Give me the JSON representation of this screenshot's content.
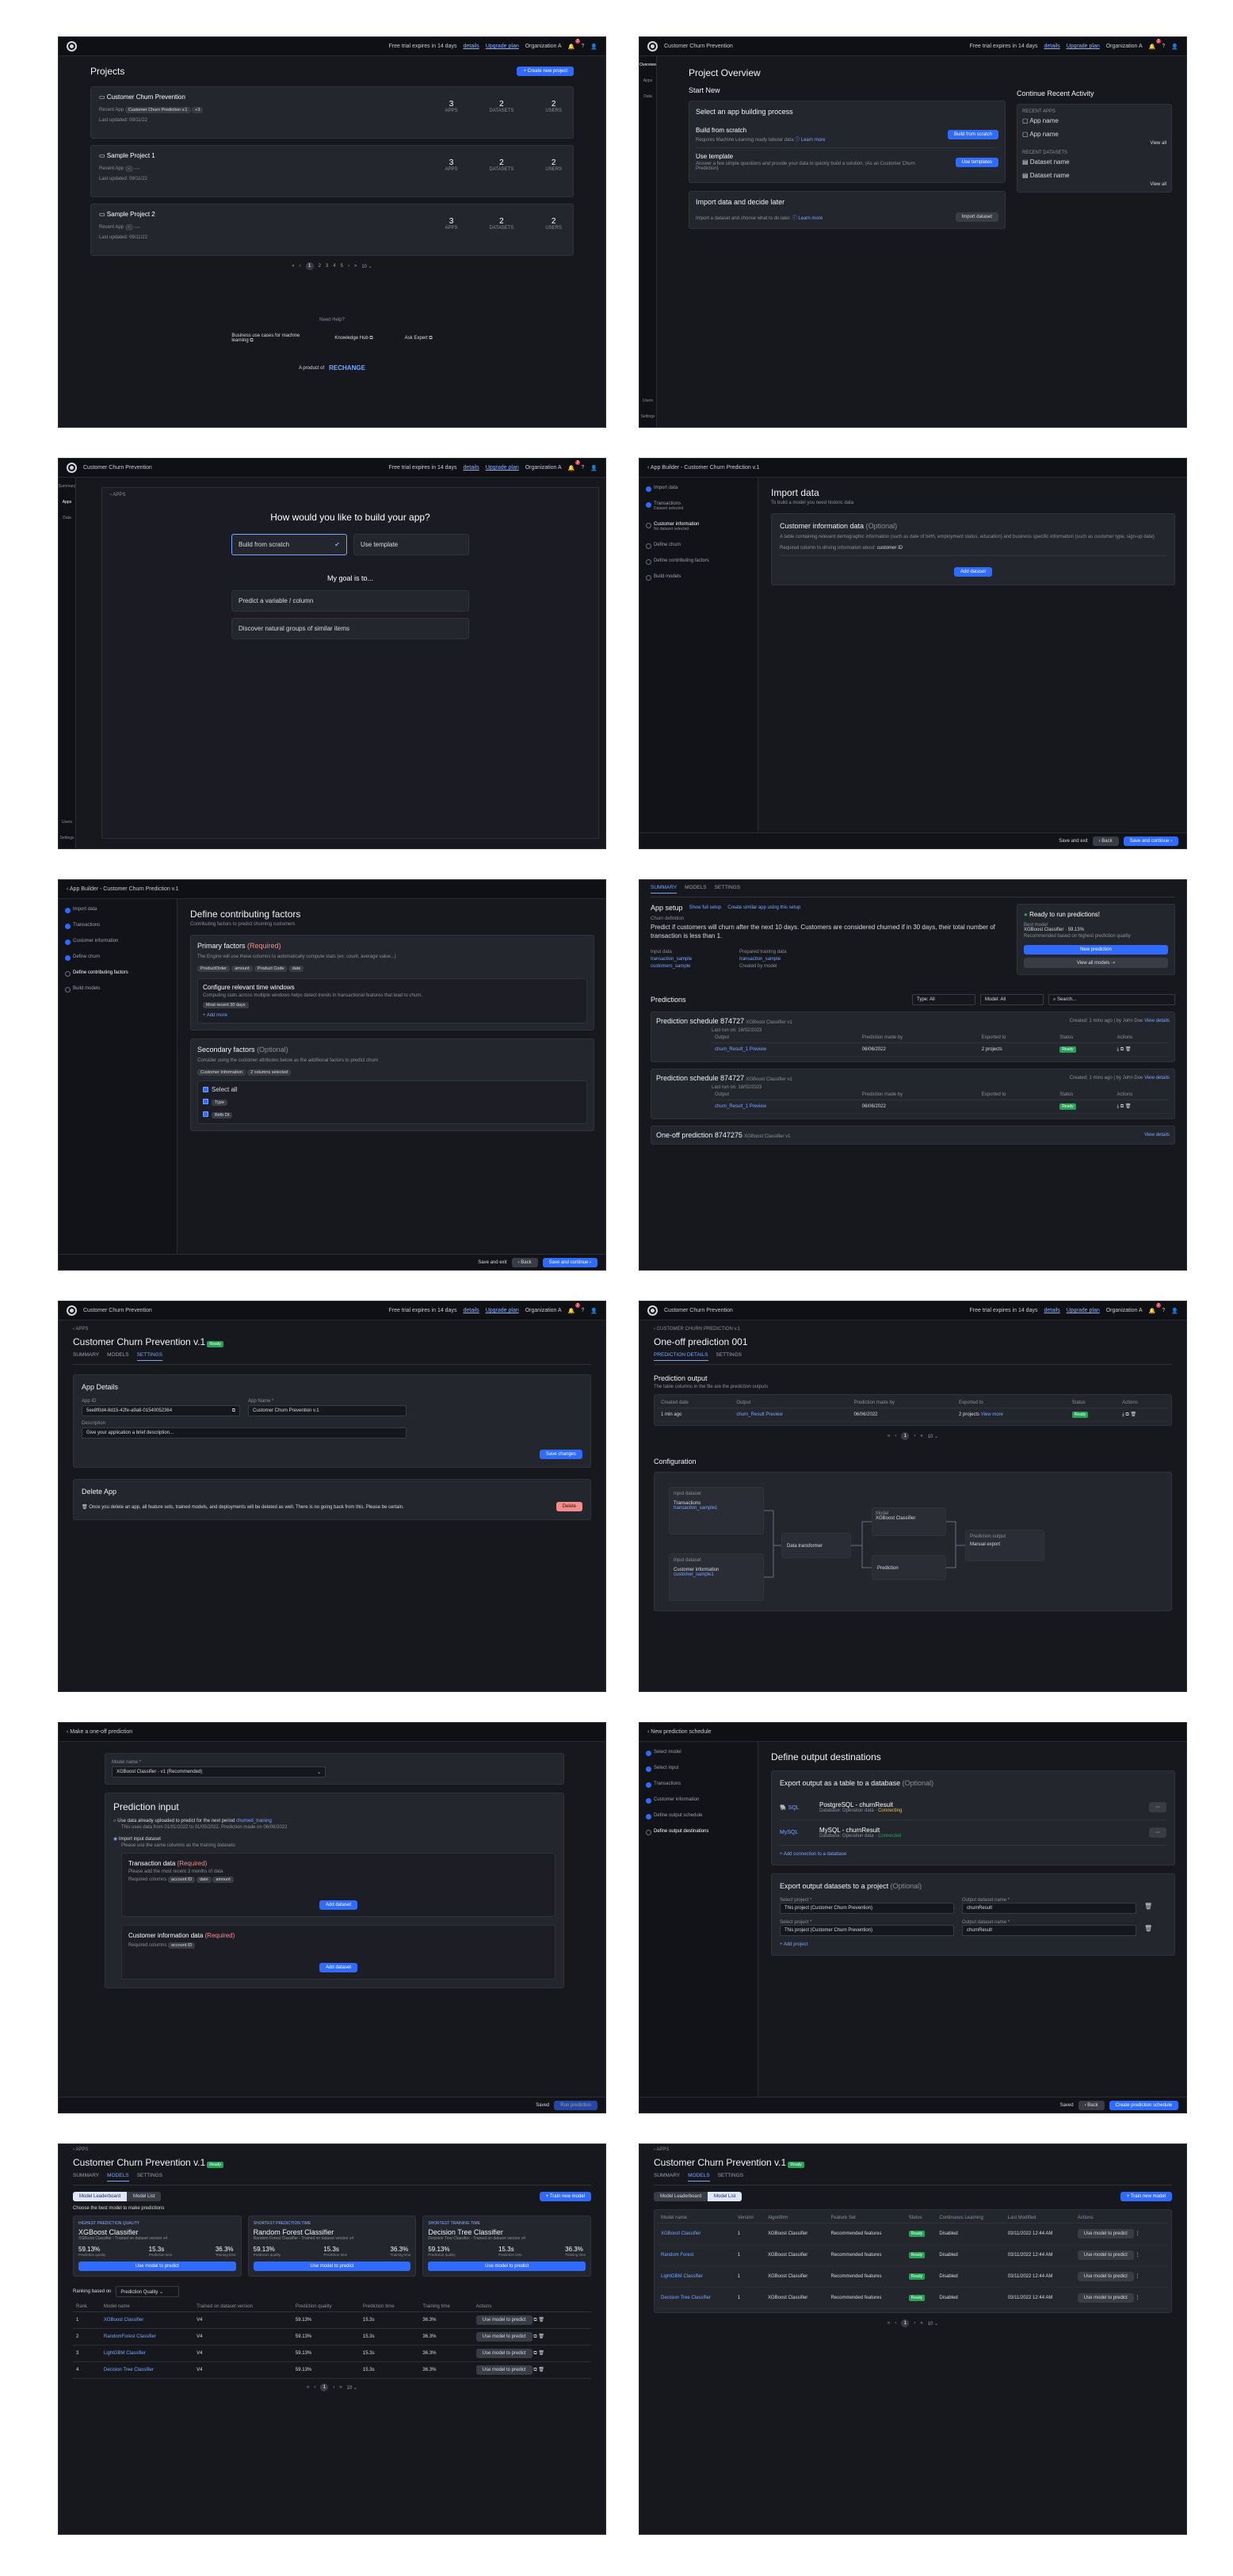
{
  "common": {
    "project_name": "Customer Churn Prevention",
    "trial": "Free trial expires in 14 days",
    "details": "details",
    "upgrade": "Upgrade plan",
    "org": "Organization A",
    "notif_count": "2"
  },
  "p1": {
    "title": "Projects",
    "create": "+ Create new project",
    "projects": [
      {
        "name": "Customer Churn Prevention",
        "recent_label": "Recent App",
        "recent_app": "Customer Churn Prediction v.1",
        "recent_more": "+3",
        "updated": "Last updated: 09/11/22",
        "apps": "3",
        "datasets": "2",
        "users": "2"
      },
      {
        "name": "Sample Project 1",
        "recent_label": "Recent App",
        "recent_app": "-",
        "recent_more": "",
        "updated": "Last updated: 09/11/22",
        "apps": "3",
        "datasets": "2",
        "users": "2"
      },
      {
        "name": "Sample Project 2",
        "recent_label": "Recent App",
        "recent_app": "-",
        "recent_more": "",
        "updated": "Last updated: 09/11/22",
        "apps": "3",
        "datasets": "2",
        "users": "2"
      }
    ],
    "stat_labels": [
      "APPS",
      "DATASETS",
      "USERS"
    ],
    "pages": [
      "«",
      "‹",
      "1",
      "2",
      "3",
      "4",
      "5",
      "›",
      "»",
      "10 ⌄"
    ],
    "help": "Need Help?",
    "help_items": [
      "Business use cases for machine learning ⧉",
      "Knowledge Hub ⧉",
      "Ask Expert ⧉"
    ],
    "product_of": "A product of",
    "brand": "RECHANGE"
  },
  "p2": {
    "title": "Project Overview",
    "start_new": "Start New",
    "select_process": "Select an app building process",
    "scratch_title": "Build from scratch",
    "scratch_desc": "Requires Machine Learning ready tabular data",
    "scratch_btn": "Build from scratch",
    "template_title": "Use template",
    "template_desc": "Answer a few simple questions and provide your data to quickly build a solution. (As an Customer Churn Prediction)",
    "template_btn": "Use templates",
    "learn_more": "ⓘ Learn more",
    "import_title": "Import data and decide later",
    "import_desc": "Import a dataset and choose what to do later.",
    "import_btn": "Import dataset",
    "continue": "Continue Recent Activity",
    "recent_apps": "RECENT APPS",
    "app_items": [
      "App name",
      "App name"
    ],
    "recent_datasets": "RECENT DATASETS",
    "dataset_items": [
      "Dataset name",
      "Dataset name"
    ],
    "view_all": "View all",
    "rail": [
      "Overview",
      "Apps",
      "Data",
      "Users",
      "Settings"
    ]
  },
  "p3": {
    "back": "‹  APPS",
    "question": "How would you like to build your app?",
    "opt1": "Build from scratch",
    "opt2": "Use template",
    "goal": "My goal is to...",
    "goal1": "Predict a variable / column",
    "goal2": "Discover natural groups of similar items",
    "rail": [
      "Summary",
      "Apps",
      "Data",
      "Users",
      "Settings"
    ]
  },
  "p4": {
    "header": "‹  App Builder - Customer Churn Prediction v.1",
    "steps": [
      "Import data",
      "Transactions",
      "Customer information",
      "Define churn",
      "Define contributing factors",
      "Build models"
    ],
    "step_subs": [
      "",
      "Dataset selected",
      "No dataset selected",
      "",
      "",
      ""
    ],
    "title": "Import data",
    "sub": "To build a model you need historic data",
    "card_title": "Customer information data",
    "optional": "(Optional)",
    "card_desc": "A table containing relevant demographic information (such as date of birth, employment status, education) and business specific information (such as customer type, sign-up date)",
    "required": "Required column to driving information about:",
    "required_val": "customer ID",
    "add": "Add dataset",
    "save_exit": "Save and exit",
    "back_btn": "‹  Back",
    "continue": "Save and continue  ›"
  },
  "p5": {
    "title": "Define contributing factors",
    "sub": "Contributing factors to predict churning customers",
    "primary": "Primary factors",
    "primary_req": "(Required)",
    "primary_desc": "The Engine will use these columns to automatically compute stats (ex: count, average value...)",
    "chips": [
      "ProductOrder",
      "amount",
      "Product Code",
      "date"
    ],
    "config_title": "Configure relevant time windows",
    "config_desc": "Computing stats across multiple windows helps detect trends in transactional features that lead to churn.",
    "window": "Most recent 30 days",
    "add_more": "+ Add more",
    "secondary": "Secondary factors",
    "secondary_opt": "(Optional)",
    "secondary_desc": "Consider using the customer attributes below as the additional factors to predict churn",
    "sec_chip1": "Customer Information",
    "sec_chip2": "2 columns selected",
    "checks": [
      "Select all",
      "Type",
      "Birth Dt"
    ],
    "save_exit": "Save and exit",
    "back_btn": "‹  Back",
    "continue": "Save and continue  ›"
  },
  "p6": {
    "tabs": [
      "SUMMARY",
      "MODELS",
      "SETTINGS"
    ],
    "app_setup": "App setup",
    "show_full": "Show full setup",
    "create_similar": "Create similar app using this setup",
    "churn_def_label": "Churn definition",
    "churn_def": "Predict if customers will churn after the next 10 days. Customers are considered churned if in 30 days, their total number of transaction is less than 1.",
    "input_label": "Input data",
    "inputs": [
      "transaction_sample",
      "customers_sample"
    ],
    "prepared_label": "Prepared training data",
    "prepared": [
      "transaction_sample",
      "Created by model"
    ],
    "ready": "Ready to run predictions!",
    "best_model_label": "Best model",
    "best_model": "XGBoost Classifier",
    "best_val": "59.13%",
    "best_note": "Recommended based on highest prediction quality",
    "new_pred": "New prediction",
    "view_models": "View all models  ⇢",
    "pred_title": "Predictions",
    "type_filter": "Type: All",
    "model_filter": "Model: All",
    "search": "Search...",
    "schedules": [
      {
        "name": "Prediction schedule 874727",
        "model": "XGBoost Classifier v1",
        "created": "Created: 1 mins ago | by John Doe",
        "run": "Last run on: 18/02/2023",
        "output": "churn_Result_1",
        "date": "06/06/2022",
        "exported": "2 projects",
        "status": "Ready"
      },
      {
        "name": "Prediction schedule 874727",
        "model": "XGBoost Classifier v1",
        "created": "Created: 1 mins ago | by John Doe",
        "run": "Last run on: 18/02/2023",
        "output": "churn_Result_1",
        "date": "06/06/2022",
        "exported": "",
        "status": "Ready"
      }
    ],
    "oneoff": "One-off prediction 8747275",
    "oneoff_model": "XGBoost Classifier v1",
    "view_details": "View details",
    "preview": "Preview",
    "view_more": "View more",
    "col_output": "Output",
    "col_made": "Prediction made by",
    "col_exported": "Exported to",
    "col_status": "Status",
    "col_actions": "Actions"
  },
  "p7": {
    "crumb": "‹  APPS",
    "app_title": "Customer Churn Prevention v.1",
    "ready": "Ready",
    "tabs": [
      "SUMMARY",
      "MODELS",
      "SETTINGS"
    ],
    "details": "App Details",
    "appid_label": "App ID",
    "appid": "5ee8f0d4-8d15-42fe-a9a8-01540052364",
    "name_label": "App Name *",
    "name": "Customer Churn Prevention v.1",
    "desc_label": "Description",
    "desc_ph": "Give your application a brief description...",
    "save": "Save changes",
    "delete_title": "Delete App",
    "delete_desc": "Once you delete an app, all feature sets, trained models, and deployments will be deleted as well. There is no going back from this. Please be certain.",
    "delete_btn": "Delete"
  },
  "p8": {
    "crumb": "‹  CUSTOMER CHURN PREDICTION v.1",
    "title": "One-off prediction 001",
    "tabs": [
      "PREDICTION DETAILS",
      "SETTINGS"
    ],
    "output_title": "Prediction output",
    "output_sub": "The table columns in the file are the prediction outputs",
    "cols": [
      "Created date",
      "Output",
      "Prediction made by",
      "Exported to",
      "Status",
      "Actions"
    ],
    "row": [
      "1 min ago",
      "churn_Result",
      "06/06/2022",
      "2 projects",
      "Ready"
    ],
    "config": "Configuration",
    "nodes": [
      "Input dataset",
      "Transactions",
      "transaction_sample1",
      "Input dataset",
      "Customer information",
      "customer_sample1",
      "Data transformer",
      "Model",
      "XGBoost Classifier",
      "Prediction",
      "Prediction output",
      "Manual export"
    ]
  },
  "p9": {
    "header": "‹  Make a one-off prediction",
    "model_label": "Model name *",
    "model": "XGBoost Classifier - v1 (Recommended)",
    "input_title": "Prediction input",
    "opt1": "Use data already uploaded to predict for the next period",
    "opt1_chip": "churned_training",
    "opt1_sub": "This uses data from 01/01/2022 to 01/05/2022. Prediction made on 06/06/2022",
    "opt2": "Import input dataset",
    "opt2_sub": "Please use the same columns as the training datasets",
    "tx_title": "Transaction data",
    "tx_req": "(Required)",
    "tx_desc": "Please add the most recent 3 months of data",
    "req_cols": "Required columns",
    "tx_cols": [
      "account ID",
      "date",
      "amount"
    ],
    "add": "Add dataset",
    "ci_title": "Customer information data",
    "ci_req": "(Required)",
    "ci_cols": [
      "account ID"
    ],
    "saved": "Saved",
    "run": "Run prediction"
  },
  "p10": {
    "header": "‹  New prediction schedule",
    "steps": [
      "Select model",
      "Select input",
      "Transactions",
      "Customer information",
      "Define output schedule",
      "Define output destinations"
    ],
    "title": "Define output destinations",
    "export_db": "Export output as a table to a database",
    "optional": "(Optional)",
    "db1": "PostgreSQL - churnResult",
    "db1_sub": "Database: Operation data",
    "db1_status": "Connecting",
    "db2": "MySQL - churnResult",
    "db2_sub": "Database: Operation data",
    "db2_status": "Connected",
    "add_conn": "+ Add connection to a database",
    "export_proj": "Export output datasets to a project",
    "project_label": "Select project *",
    "project": "This project (Customer Churn Prevention)",
    "out_label": "Output dataset name *",
    "out": "churnResult",
    "add_project": "+ Add project",
    "saved": "Saved",
    "back_btn": "‹  Back",
    "create": "Create prediction schedule"
  },
  "p11": {
    "crumb": "‹  APPS",
    "app_title": "Customer Churn Prevention v.1",
    "ready": "Ready",
    "tabs": [
      "SUMMARY",
      "MODELS",
      "SETTINGS"
    ],
    "toggle": [
      "Model Leaderboard",
      "Model List"
    ],
    "train": "+ Train new model",
    "choose": "Choose the best model to make predictions",
    "cards": [
      {
        "tag": "HIGHEST PREDICTION QUALITY",
        "name": "XGBoost Classifier",
        "sub": "XGBoost Classifier - Trained on dataset version v4",
        "q": "59.13%",
        "t": "15.3s",
        "a": "36.3%"
      },
      {
        "tag": "SHORTEST PREDICTION TIME",
        "name": "Random Forest Classifier",
        "sub": "Random Forest Classifier - Trained on dataset version v4",
        "q": "59.13%",
        "t": "15.3s",
        "a": "36.3%"
      },
      {
        "tag": "SHORTEST TRAINING TIME",
        "name": "Decision Tree Classifier",
        "sub": "Decision Tree Classifier - Trained on dataset version v4",
        "q": "59.13%",
        "t": "15.3s",
        "a": "36.3%"
      }
    ],
    "metric_labels": [
      "Prediction quality",
      "Prediction time",
      "Training time"
    ],
    "use": "Use model to predict",
    "ranking": "Ranking based on",
    "ranking_val": "Prediction Quality ⌄",
    "cols": [
      "Rank",
      "Model name",
      "Trained on dataset version",
      "Prediction quality",
      "Prediction time",
      "Training time",
      "Actions"
    ],
    "rows": [
      {
        "rank": "1",
        "name": "XGBoost Classifier",
        "ver": "V4",
        "q": "59.13%",
        "p": "15.3s",
        "t": "36.3%"
      },
      {
        "rank": "2",
        "name": "RandomForest Classifier",
        "ver": "V4",
        "q": "59.13%",
        "p": "15.3s",
        "t": "36.3%"
      },
      {
        "rank": "3",
        "name": "LightGBM Classifier",
        "ver": "V4",
        "q": "59.13%",
        "p": "15.3s",
        "t": "36.3%"
      },
      {
        "rank": "4",
        "name": "Decision Tree Classifier",
        "ver": "V4",
        "q": "59.13%",
        "p": "15.3s",
        "t": "36.3%"
      }
    ],
    "pages": [
      "«",
      "‹",
      "1",
      "›",
      "»",
      "10 ⌄"
    ]
  },
  "p12": {
    "crumb": "‹  APPS",
    "app_title": "Customer Churn Prevention v.1",
    "ready": "Ready",
    "tabs": [
      "SUMMARY",
      "MODELS",
      "SETTINGS"
    ],
    "toggle": [
      "Model Leaderboard",
      "Model List"
    ],
    "train": "+ Train new model",
    "cols": [
      "Model name",
      "Version",
      "Algorithm",
      "Feature Set",
      "Status",
      "Continuous Learning",
      "Last Modified",
      "Actions"
    ],
    "rows": [
      {
        "name": "XGBoost Classifier",
        "ver": "1",
        "alg": "XGBoost Classifier",
        "fs": "Recommended features",
        "st": "Ready",
        "cl": "Disabled",
        "mod": "03/11/2022 12:44 AM"
      },
      {
        "name": "Random Forest",
        "ver": "1",
        "alg": "XGBoost Classifier",
        "fs": "Recommended features",
        "st": "Ready",
        "cl": "Disabled",
        "mod": "03/11/2022 12:44 AM"
      },
      {
        "name": "LightGBM Classifier",
        "ver": "1",
        "alg": "XGBoost Classifier",
        "fs": "Recommended features",
        "st": "Ready",
        "cl": "Disabled",
        "mod": "03/11/2022 12:44 AM"
      },
      {
        "name": "Decision Tree Classifier",
        "ver": "1",
        "alg": "XGBoost Classifier",
        "fs": "Recommended features",
        "st": "Ready",
        "cl": "Disabled",
        "mod": "03/11/2022 12:44 AM"
      }
    ],
    "use": "Use model to predict",
    "pages": [
      "«",
      "‹",
      "1",
      "›",
      "»",
      "10 ⌄"
    ]
  }
}
